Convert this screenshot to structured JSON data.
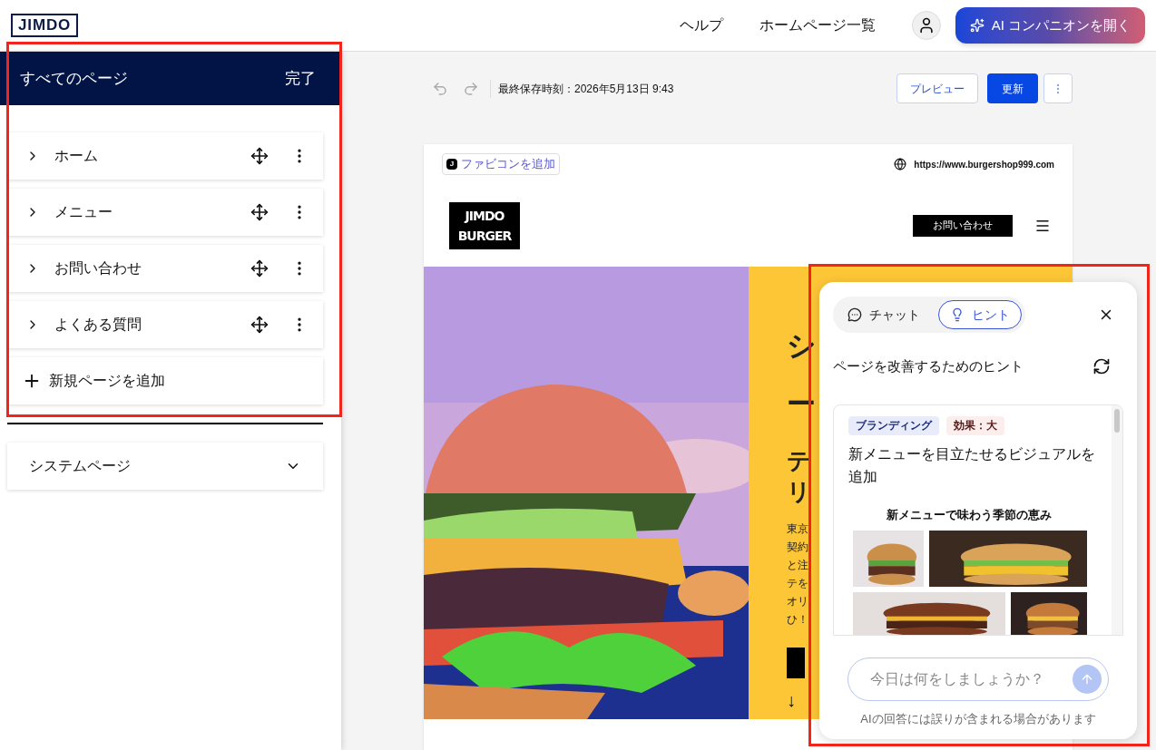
{
  "header": {
    "logo": "JIMDO",
    "nav": [
      "ヘルプ",
      "ホームページ一覧"
    ],
    "ai_button": "AI コンパニオンを開く"
  },
  "sidebar": {
    "title": "すべてのページ",
    "done": "完了",
    "pages": [
      {
        "label": "ホーム",
        "expanded": false
      },
      {
        "label": "メニュー",
        "expanded": false
      },
      {
        "label": "お問い合わせ",
        "expanded": false
      },
      {
        "label": "よくある質問",
        "expanded": false
      }
    ],
    "add_page": "新規ページを追加",
    "system_pages": "システムページ"
  },
  "editor_toolbar": {
    "saved": "最終保存時刻：2026年5月13日 9:43",
    "preview": "プレビュー",
    "update": "更新"
  },
  "site_preview": {
    "favicon_letter": "J",
    "favicon_button": "ファビコンを追加",
    "url": "https://www.burgershop999.com",
    "logo_lines": [
      "JIMDO",
      "BURGER"
    ],
    "contact_button": "お問い合わせ",
    "hero": {
      "heading": [
        "シ",
        "ー"
      ],
      "subheading": [
        "テ",
        "リ"
      ],
      "body": [
        "東京",
        "契約",
        "と注",
        "テを",
        "オリ",
        "ひ！"
      ],
      "arrow": "↓"
    }
  },
  "ai_panel": {
    "tabs": [
      {
        "label": "チャット",
        "selected": false
      },
      {
        "label": "ヒント",
        "selected": true
      }
    ],
    "title": "ページを改善するためのヒント",
    "hint": {
      "tags": [
        {
          "label": "ブランディング",
          "kind": "category"
        },
        {
          "label": "効果：大",
          "kind": "impact"
        }
      ],
      "title": "新メニューを目立たせるビジュアルを追加",
      "preview_caption": "新メニューで味わう季節の恵み"
    },
    "input": {
      "placeholder": "今日は何をしましょうか？"
    },
    "disclaimer": "AIの回答には誤りが含まれる場合があります"
  }
}
